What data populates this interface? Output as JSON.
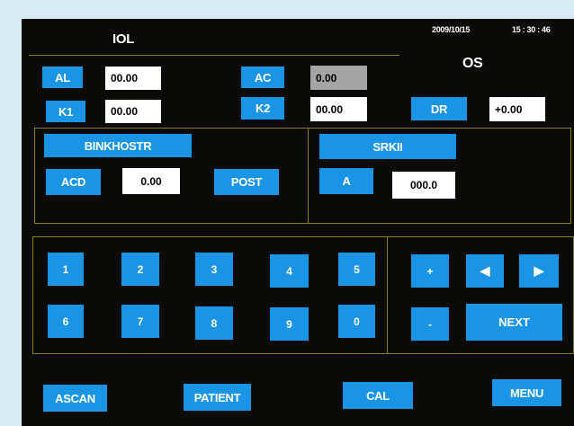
{
  "header": {
    "title": "IOL",
    "date": "2009/10/15",
    "time": "15 : 30 : 46",
    "eye": "OS"
  },
  "params": {
    "al": {
      "label": "AL",
      "value": "00.00"
    },
    "ac": {
      "label": "AC",
      "value": "0.00"
    },
    "k1": {
      "label": "K1",
      "value": "00.00"
    },
    "k2": {
      "label": "K2",
      "value": "00.00"
    },
    "dr": {
      "label": "DR",
      "value": "+0.00"
    }
  },
  "formula_left": {
    "name": "BINKHOSTR",
    "acd_label": "ACD",
    "acd_value": "0.00",
    "post_label": "POST"
  },
  "formula_right": {
    "name": "SRKII",
    "a_label": "A",
    "a_value": "000.0"
  },
  "keypad": {
    "digits": [
      "1",
      "2",
      "3",
      "4",
      "5",
      "6",
      "7",
      "8",
      "9",
      "0"
    ],
    "plus": "+",
    "minus": "-",
    "left_arrow": "◀",
    "right_arrow": "▶",
    "next": "NEXT"
  },
  "footer": {
    "ascan": "ASCAN",
    "patient": "PATIENT",
    "cal": "CAL",
    "menu": "MENU"
  },
  "colors": {
    "button": "#1a95e6",
    "frame": "#8a7d1c",
    "background": "#0a0a06"
  }
}
